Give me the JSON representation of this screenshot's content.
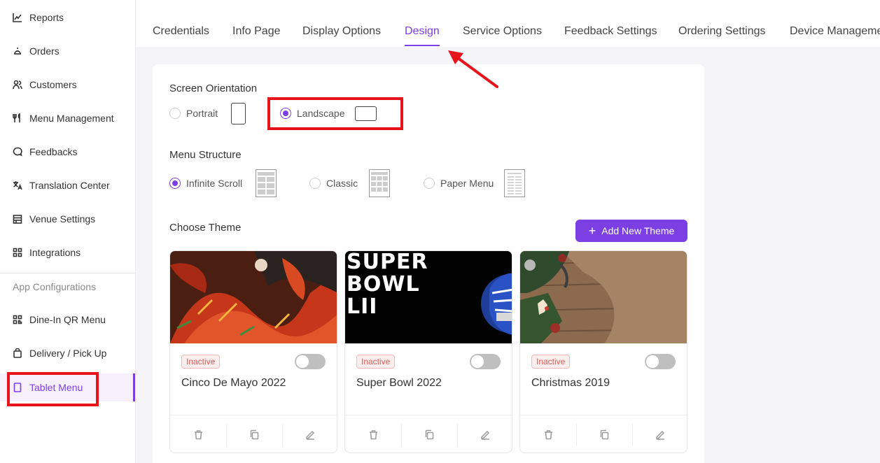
{
  "sidebar": {
    "items": [
      {
        "label": "Reports",
        "icon": "chart-line-icon"
      },
      {
        "label": "Orders",
        "icon": "bell-icon"
      },
      {
        "label": "Customers",
        "icon": "users-icon"
      },
      {
        "label": "Menu Management",
        "icon": "utensils-icon"
      },
      {
        "label": "Feedbacks",
        "icon": "chat-bubble-icon"
      },
      {
        "label": "Translation Center",
        "icon": "translate-icon"
      },
      {
        "label": "Venue Settings",
        "icon": "store-icon"
      },
      {
        "label": "Integrations",
        "icon": "integrations-icon"
      }
    ],
    "section_label": "App Configurations",
    "app_items": [
      {
        "label": "Dine-In QR Menu",
        "icon": "qr-code-icon"
      },
      {
        "label": "Delivery / Pick Up",
        "icon": "bag-icon"
      },
      {
        "label": "Tablet Menu",
        "icon": "tablet-icon",
        "active": true
      }
    ]
  },
  "tabs": [
    {
      "label": "Credentials"
    },
    {
      "label": "Info Page"
    },
    {
      "label": "Display Options"
    },
    {
      "label": "Design",
      "active": true
    },
    {
      "label": "Service Options"
    },
    {
      "label": "Feedback Settings"
    },
    {
      "label": "Ordering Settings"
    },
    {
      "label": "Device Management"
    }
  ],
  "design": {
    "orientation": {
      "title": "Screen Orientation",
      "options": [
        {
          "label": "Portrait",
          "checked": false
        },
        {
          "label": "Landscape",
          "checked": true
        }
      ]
    },
    "menu_structure": {
      "title": "Menu Structure",
      "options": [
        {
          "label": "Infinite Scroll",
          "checked": true
        },
        {
          "label": "Classic",
          "checked": false
        },
        {
          "label": "Paper Menu",
          "checked": false
        }
      ]
    },
    "themes": {
      "title": "Choose Theme",
      "add_button_label": "Add New Theme",
      "items": [
        {
          "name": "Cinco De Mayo 2022",
          "status": "Inactive",
          "enabled": false
        },
        {
          "name": "Super Bowl 2022",
          "status": "Inactive",
          "enabled": false,
          "image_text": [
            "SUPER",
            "BOWL",
            "LII"
          ]
        },
        {
          "name": "Christmas 2019",
          "status": "Inactive",
          "enabled": false
        }
      ]
    }
  },
  "colors": {
    "accent": "#7c3fe4",
    "highlight": "#e8141c",
    "inactive_badge": "#e05a5a"
  }
}
